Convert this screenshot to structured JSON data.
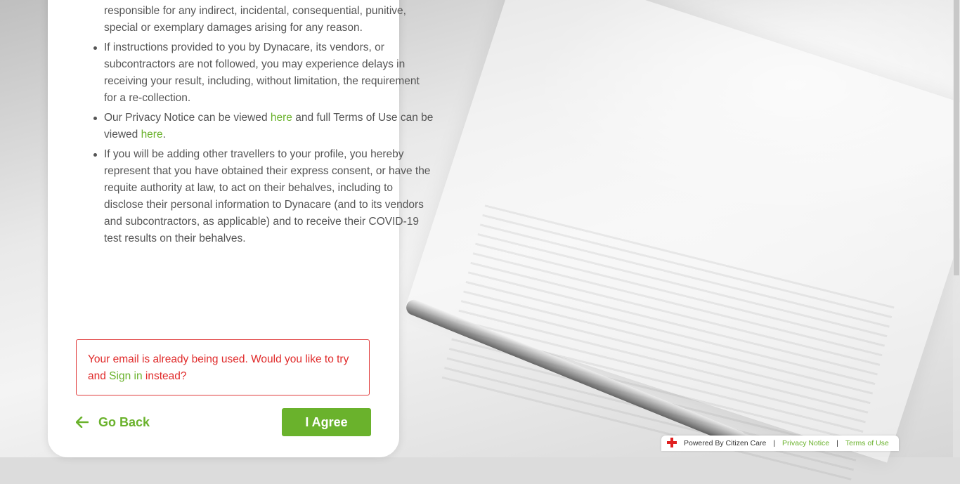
{
  "terms": {
    "items": [
      "will Dynacare (including its vendors and subcontractors) be responsible for any indirect, incidental, consequential, punitive, special or exemplary damages arising for any reason.",
      "If instructions provided to you by Dynacare, its vendors, or subcontractors are not followed, you may experience delays in receiving your result, including, without limitation, the requirement for a re-collection.",
      "If you will be adding other travellers to your profile, you hereby represent that you have obtained their express consent, or have the requite authority at law, to act on their behalves, including to disclose their personal information to Dynacare (and to its vendors and subcontractors, as applicable) and to receive their COVID-19 test results on their behalves."
    ],
    "privacy_item": {
      "text1": "Our Privacy Notice can be viewed ",
      "link1": "here",
      "text2": " and full Terms of Use can be viewed ",
      "link2": "here",
      "text3": "."
    }
  },
  "alert": {
    "text1": "Your email is already being used. Would you like to try and ",
    "link": "Sign in",
    "text2": " instead?"
  },
  "actions": {
    "go_back_label": "Go Back",
    "agree_label": "I Agree"
  },
  "footer": {
    "powered_by": "Powered By Citizen Care",
    "separator": "|",
    "privacy_label": "Privacy Notice",
    "terms_label": "Terms of Use"
  },
  "colors": {
    "accent": "#6ab22c",
    "error": "#e02a2a",
    "text": "#555555"
  }
}
